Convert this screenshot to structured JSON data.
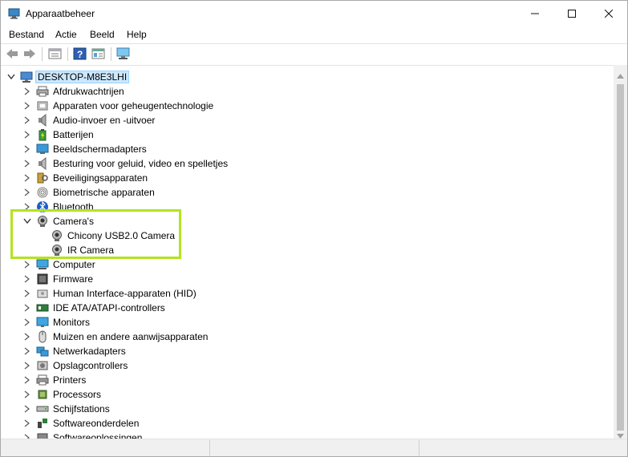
{
  "window": {
    "title": "Apparaatbeheer",
    "minimize_icon": "minimize-icon",
    "maximize_icon": "maximize-icon",
    "close_icon": "close-icon"
  },
  "menu": [
    "Bestand",
    "Actie",
    "Beeld",
    "Help"
  ],
  "toolbar": [
    "back-arrow-icon",
    "forward-arrow-icon",
    "properties-icon",
    "help-icon",
    "view-icon",
    "monitor-icon"
  ],
  "tree": {
    "root": "DESKTOP-M8E3LHI",
    "categories": [
      {
        "label": "Afdrukwachtrijen",
        "icon": "printer-queue-icon"
      },
      {
        "label": "Apparaten voor geheugentechnologie",
        "icon": "memory-device-icon"
      },
      {
        "label": "Audio-invoer en -uitvoer",
        "icon": "speaker-icon"
      },
      {
        "label": "Batterijen",
        "icon": "battery-icon"
      },
      {
        "label": "Beeldschermadapters",
        "icon": "display-adapter-icon"
      },
      {
        "label": "Besturing voor geluid, video en spelletjes",
        "icon": "sound-icon"
      },
      {
        "label": "Beveiligingsapparaten",
        "icon": "security-device-icon"
      },
      {
        "label": "Biometrische apparaten",
        "icon": "fingerprint-icon"
      },
      {
        "label": "Bluetooth",
        "icon": "bluetooth-icon"
      },
      {
        "label": "Camera's",
        "icon": "camera-icon",
        "expanded": true,
        "children": [
          {
            "label": "Chicony USB2.0 Camera",
            "icon": "camera-icon"
          },
          {
            "label": "IR Camera",
            "icon": "camera-icon"
          }
        ]
      },
      {
        "label": "Computer",
        "icon": "computer-icon"
      },
      {
        "label": "Firmware",
        "icon": "firmware-icon"
      },
      {
        "label": "Human Interface-apparaten (HID)",
        "icon": "hid-icon"
      },
      {
        "label": "IDE ATA/ATAPI-controllers",
        "icon": "ide-controller-icon"
      },
      {
        "label": "Monitors",
        "icon": "monitor-icon"
      },
      {
        "label": "Muizen en andere aanwijsapparaten",
        "icon": "mouse-icon"
      },
      {
        "label": "Netwerkadapters",
        "icon": "network-adapter-icon"
      },
      {
        "label": "Opslagcontrollers",
        "icon": "storage-controller-icon"
      },
      {
        "label": "Printers",
        "icon": "printer-icon"
      },
      {
        "label": "Processors",
        "icon": "processor-icon"
      },
      {
        "label": "Schijfstations",
        "icon": "disk-drive-icon"
      },
      {
        "label": "Softwareonderdelen",
        "icon": "software-component-icon"
      },
      {
        "label": "Softwareoplossingen",
        "icon": "software-device-icon"
      }
    ]
  },
  "colors": {
    "highlight_border": "#b4e31e",
    "selection_bg": "#cce8ff"
  }
}
